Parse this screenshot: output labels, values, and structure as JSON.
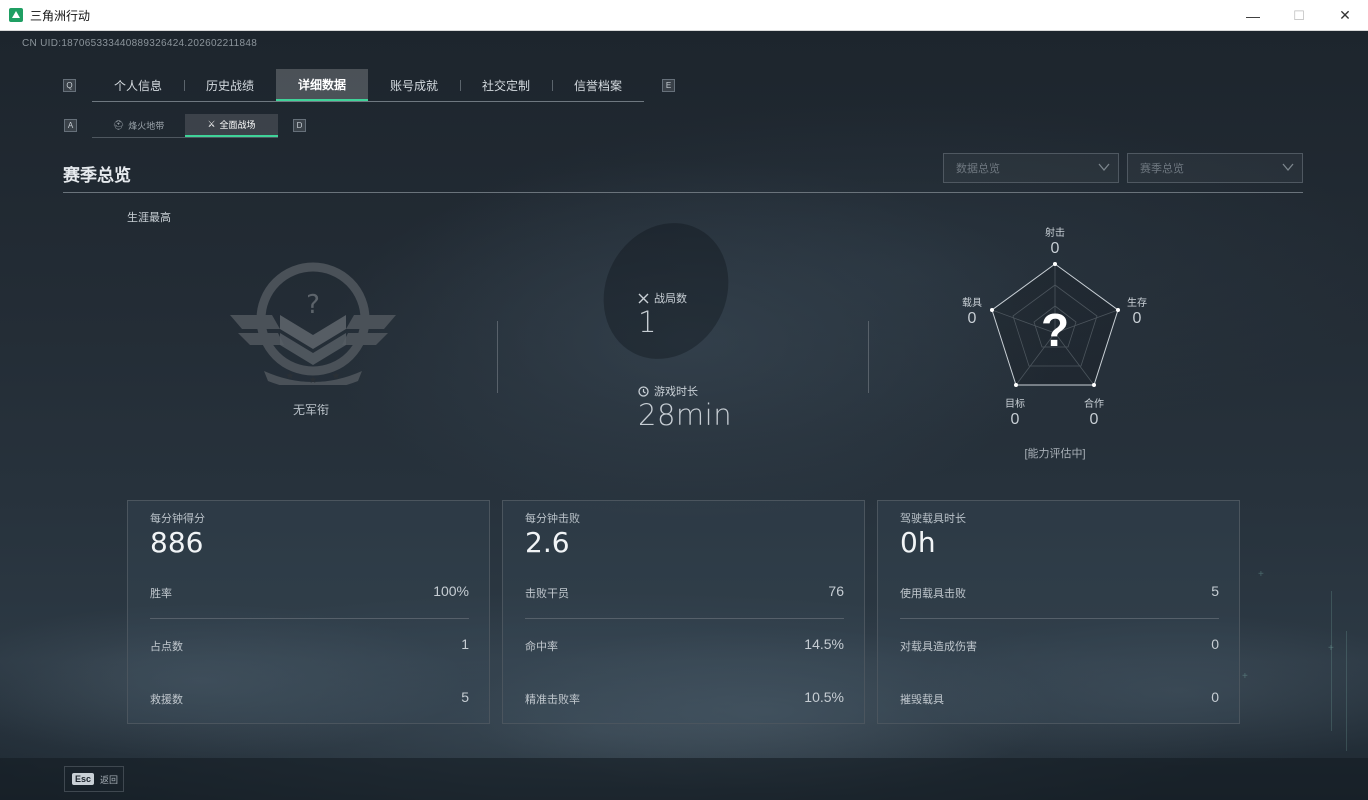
{
  "window": {
    "title": "三角洲行动",
    "min_glyph": "—",
    "max_glyph": "☐",
    "close_glyph": "✕"
  },
  "uid": "CN UID:1870653334408893264​24.202602211848",
  "tabs": {
    "left_key": "Q",
    "right_key": "E",
    "items": [
      {
        "label": "个人信息",
        "active": false
      },
      {
        "label": "历史战绩",
        "active": false
      },
      {
        "label": "详细数据",
        "active": true
      },
      {
        "label": "账号成就",
        "active": false
      },
      {
        "label": "社交定制",
        "active": false
      },
      {
        "label": "信誉档案",
        "active": false
      }
    ]
  },
  "subtabs": {
    "left_key": "A",
    "right_key": "D",
    "items": [
      {
        "icon": "⛑",
        "label": "烽火地带",
        "active": false
      },
      {
        "icon": "⚔",
        "label": "全面战场",
        "active": true
      }
    ]
  },
  "section": {
    "title": "赛季总览"
  },
  "filters": {
    "data_placeholder": "数据总览",
    "season_placeholder": "赛季总览"
  },
  "career": {
    "label": "生涯最高",
    "rank": "无军衔"
  },
  "overview": {
    "matches_label": "战局数",
    "matches_value": "1",
    "time_label": "游戏时长",
    "time_value": "28min"
  },
  "radar": {
    "labels": {
      "shoot": "射击",
      "survive": "生存",
      "coop": "合作",
      "target": "目标",
      "vehicle": "载具"
    },
    "values": {
      "shoot": "0",
      "survive": "0",
      "coop": "0",
      "target": "0",
      "vehicle": "0"
    },
    "center_mark": "?",
    "status": "[能力评估中]"
  },
  "cards": [
    {
      "title": "每分钟得分",
      "big": "886",
      "rows": [
        {
          "label": "胜率",
          "value": "100%"
        },
        {
          "label": "占点数",
          "value": "1"
        },
        {
          "label": "救援数",
          "value": "5"
        }
      ]
    },
    {
      "title": "每分钟击败",
      "big": "2.6",
      "rows": [
        {
          "label": "击败干员",
          "value": "76"
        },
        {
          "label": "命中率",
          "value": "14.5%"
        },
        {
          "label": "精准击败率",
          "value": "10.5%"
        }
      ]
    },
    {
      "title": "驾驶载具时长",
      "big": "0h",
      "rows": [
        {
          "label": "使用载具击败",
          "value": "5"
        },
        {
          "label": "对载具造成伤害",
          "value": "0"
        },
        {
          "label": "摧毁载具",
          "value": "0"
        }
      ]
    }
  ],
  "footer": {
    "esc_key": "Esc",
    "esc_label": "返回"
  },
  "colors": {
    "accent": "#3fd399",
    "panel": "#1d252d"
  }
}
